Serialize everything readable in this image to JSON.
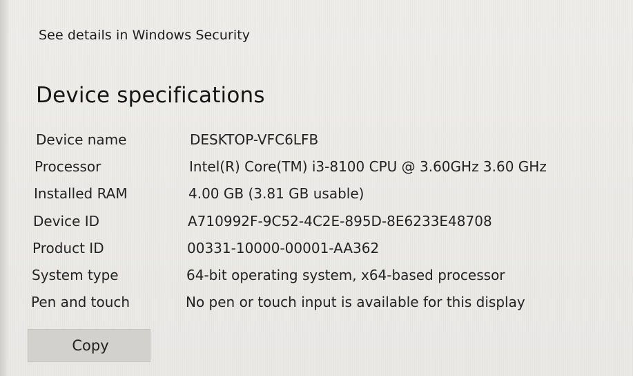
{
  "security": {
    "link_label": "See details in Windows Security"
  },
  "device_specs": {
    "title": "Device specifications",
    "rows": [
      {
        "label": "Device name",
        "value": "DESKTOP-VFC6LFB"
      },
      {
        "label": "Processor",
        "value": "Intel(R) Core(TM) i3-8100 CPU @ 3.60GHz   3.60 GHz"
      },
      {
        "label": "Installed RAM",
        "value": "4.00 GB (3.81 GB usable)"
      },
      {
        "label": "Device ID",
        "value": "A710992F-9C52-4C2E-895D-8E6233E48708"
      },
      {
        "label": "Product ID",
        "value": "00331-10000-00001-AA362"
      },
      {
        "label": "System type",
        "value": "64-bit operating system, x64-based processor"
      },
      {
        "label": "Pen and touch",
        "value": "No pen or touch input is available for this display"
      }
    ],
    "copy_label": "Copy"
  }
}
